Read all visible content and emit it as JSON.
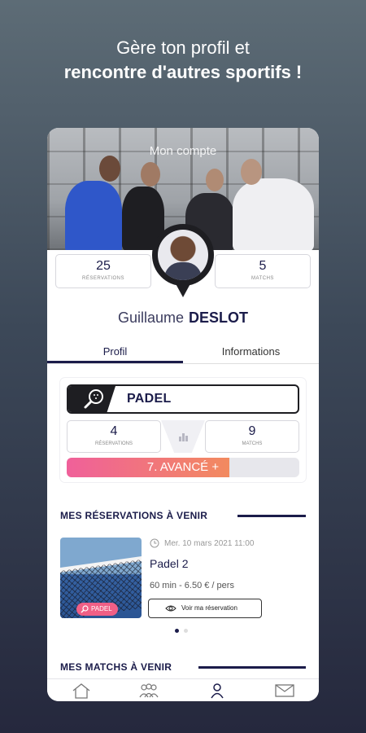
{
  "promo": {
    "line1": "Gère ton profil et",
    "line2": "rencontre d'autres sportifs !"
  },
  "screen": {
    "title": "Mon compte",
    "stats": [
      {
        "value": "25",
        "label": "RÉSERVATIONS"
      },
      {
        "value": "5",
        "label": "MATCHS"
      }
    ],
    "user": {
      "first_name": "Guillaume",
      "last_name": "DESLOT"
    },
    "tabs": [
      {
        "label": "Profil",
        "active": true
      },
      {
        "label": "Informations",
        "active": false
      }
    ],
    "sport": {
      "name": "PADEL",
      "icon": "padel-racket-icon",
      "stats": [
        {
          "value": "4",
          "label": "RÉSERVATIONS"
        },
        {
          "value": "9",
          "label": "MATCHS"
        }
      ],
      "level_label": "7. AVANCÉ +",
      "level_fraction": 0.7
    },
    "upcoming_bookings": {
      "title": "MES RÉSERVATIONS À VENIR",
      "items": [
        {
          "date": "Mer. 10 mars 2021 11:00",
          "court": "Padel 2",
          "details": "60 min - 6.50 € / pers",
          "tag": "PADEL",
          "button_label": "Voir ma réservation"
        }
      ],
      "page_count": 2,
      "active_page": 1
    },
    "upcoming_matches": {
      "title": "MES MATCHS À VENIR"
    },
    "nav": [
      {
        "icon": "home-icon",
        "active": false
      },
      {
        "icon": "community-icon",
        "active": false
      },
      {
        "icon": "profile-icon",
        "active": true
      },
      {
        "icon": "mail-icon",
        "active": false
      }
    ]
  },
  "colors": {
    "navy": "#1b1c4a",
    "level_start": "#f0609a",
    "level_end": "#f28a5f",
    "tag": "#f05f86"
  }
}
